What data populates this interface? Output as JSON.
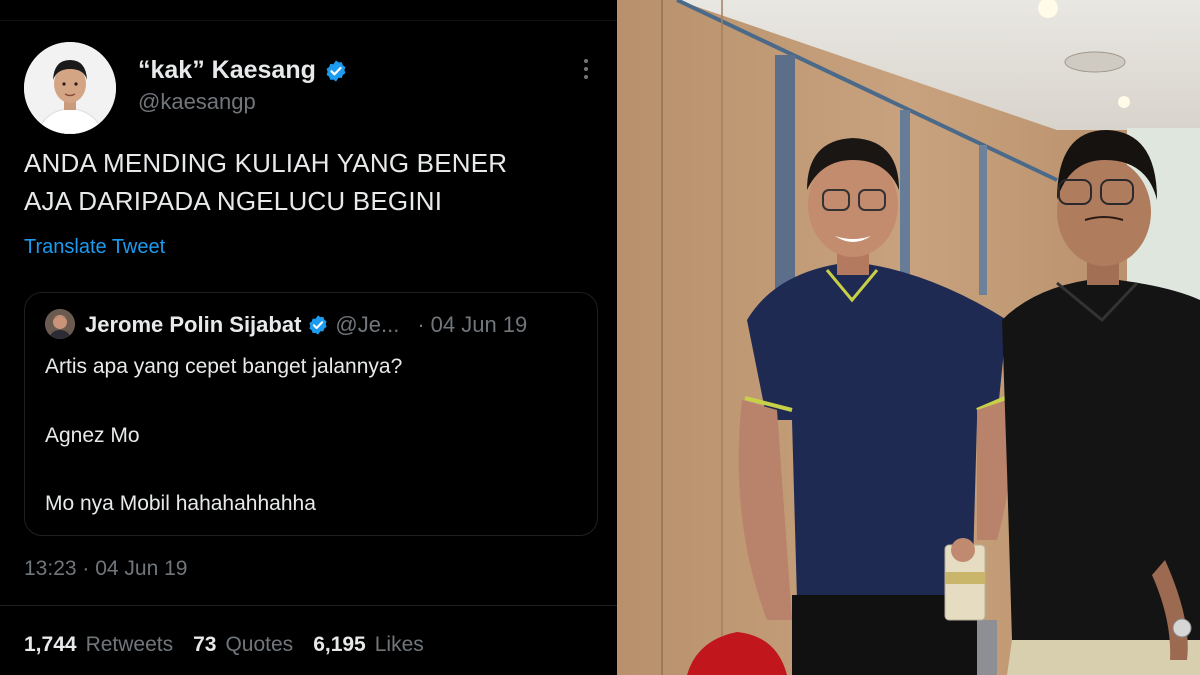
{
  "tweet": {
    "display_name": "“kak” Kaesang",
    "handle": "@kaesangp",
    "text_line1": "ANDA MENDING KULIAH YANG BENER",
    "text_line2": "AJA DARIPADA NGELUCU BEGINI",
    "translate_link": "Translate Tweet",
    "timestamp": "13:23 · 04 Jun 19",
    "quote": {
      "name": "Jerome Polin Sijabat",
      "handle": "@Je...",
      "separator": "·",
      "date": "04 Jun 19",
      "line1": "Artis apa yang cepet banget jalannya?",
      "line2": "Agnez Mo",
      "line3": "Mo nya Mobil hahahahhahha"
    },
    "stats": [
      {
        "count": "1,744",
        "label": "Retweets"
      },
      {
        "count": "73",
        "label": "Quotes"
      },
      {
        "count": "6,195",
        "label": "Likes"
      }
    ]
  },
  "icons": {
    "verified": "verified-badge-icon",
    "more": "more-options-icon"
  },
  "colors": {
    "background": "#000000",
    "text_primary": "#e7e9ea",
    "text_secondary": "#71767b",
    "link": "#1d9bf0",
    "verified": "#1d9bf0"
  }
}
